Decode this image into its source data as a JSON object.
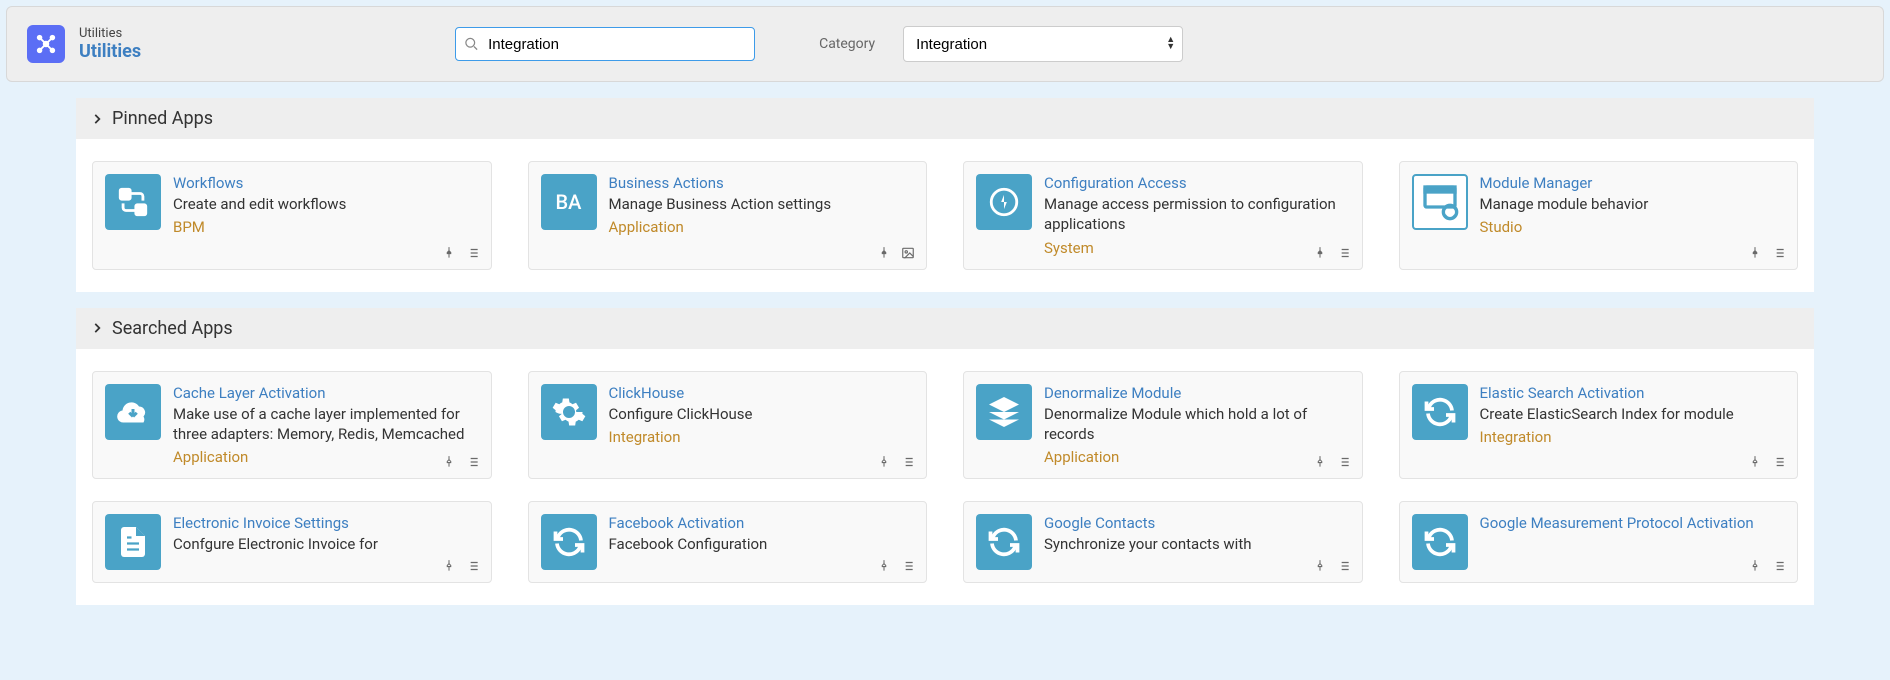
{
  "header": {
    "subtitle": "Utilities",
    "title": "Utilities",
    "search_value": "Integration",
    "search_placeholder": "",
    "category_label": "Category",
    "category_selected": "Integration"
  },
  "sections": {
    "pinned": {
      "title": "Pinned Apps",
      "items": [
        {
          "title": "Workflows",
          "desc": "Create and edit workflows",
          "tag": "BPM",
          "icon": "workflow",
          "pin_style": "solid",
          "secondary_icon": "list"
        },
        {
          "title": "Business Actions",
          "desc": "Manage Business Action settings",
          "tag": "Application",
          "icon": "ba-text",
          "pin_style": "solid",
          "secondary_icon": "image"
        },
        {
          "title": "Configuration Access",
          "desc": "Manage access permission to configuration applications",
          "tag": "System",
          "icon": "gear-bolt",
          "pin_style": "solid",
          "secondary_icon": "list"
        },
        {
          "title": "Module Manager",
          "desc": "Manage module behavior",
          "tag": "Studio",
          "icon": "module",
          "pin_style": "solid",
          "secondary_icon": "list"
        }
      ]
    },
    "searched": {
      "title": "Searched Apps",
      "items": [
        {
          "title": "Cache Layer Activation",
          "desc": "Make use of a cache layer implemented for three adapters: Memory, Redis, Memcached",
          "tag": "Application",
          "icon": "cloud-down",
          "pin_style": "outline",
          "secondary_icon": "list"
        },
        {
          "title": "ClickHouse",
          "desc": "Configure ClickHouse",
          "tag": "Integration",
          "icon": "gear",
          "pin_style": "outline",
          "secondary_icon": "list"
        },
        {
          "title": "Denormalize Module",
          "desc": "Denormalize Module which hold a lot of records",
          "tag": "Application",
          "icon": "stack",
          "pin_style": "outline",
          "secondary_icon": "list"
        },
        {
          "title": "Elastic Search Activation",
          "desc": "Create ElasticSearch Index for module",
          "tag": "Integration",
          "icon": "sync",
          "pin_style": "outline",
          "secondary_icon": "list"
        },
        {
          "title": "Electronic Invoice Settings",
          "desc": "Confgure Electronic Invoice for",
          "tag": "",
          "icon": "doc",
          "pin_style": "outline",
          "secondary_icon": "list"
        },
        {
          "title": "Facebook Activation",
          "desc": "Facebook Configuration",
          "tag": "",
          "icon": "sync",
          "pin_style": "outline",
          "secondary_icon": "list"
        },
        {
          "title": "Google Contacts",
          "desc": "Synchronize your contacts with",
          "tag": "",
          "icon": "sync",
          "pin_style": "outline",
          "secondary_icon": "list"
        },
        {
          "title": "Google Measurement Protocol Activation",
          "desc": "",
          "tag": "",
          "icon": "sync",
          "pin_style": "outline",
          "secondary_icon": "list"
        }
      ]
    }
  }
}
